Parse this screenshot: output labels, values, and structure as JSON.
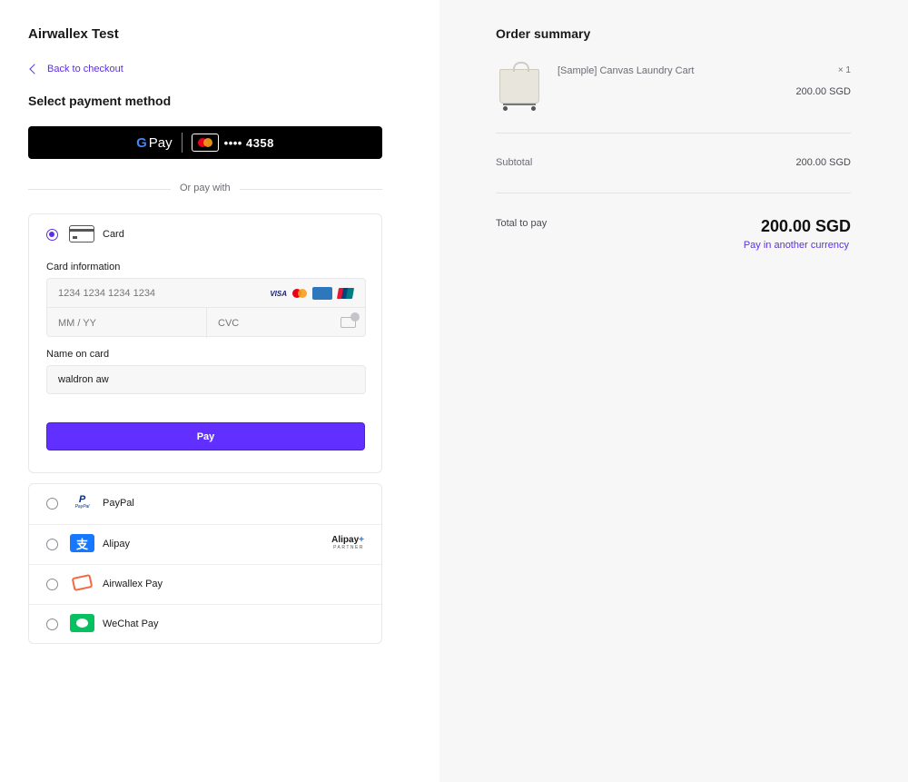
{
  "merchant": {
    "name": "Airwallex Test"
  },
  "nav": {
    "back_label": "Back to checkout"
  },
  "payment": {
    "title": "Select payment method",
    "google_pay": {
      "label": "Pay",
      "card_digits": "•••• 4358"
    },
    "divider_text": "Or pay with",
    "card": {
      "label": "Card",
      "info_label": "Card information",
      "number_placeholder": "1234 1234 1234 1234",
      "expiry_placeholder": "MM / YY",
      "cvc_placeholder": "CVC",
      "brands": {
        "visa": "VISA"
      },
      "name_label": "Name on card",
      "name_value": "waldron aw",
      "pay_button": "Pay"
    },
    "methods": [
      {
        "label": "PayPal",
        "icon": "paypal-icon"
      },
      {
        "label": "Alipay",
        "icon": "alipay-icon",
        "partner_badge": "Alipay",
        "partner_sub": "PARTNER"
      },
      {
        "label": "Airwallex Pay",
        "icon": "airwallex-pay-icon"
      },
      {
        "label": "WeChat Pay",
        "icon": "wechat-pay-icon"
      }
    ]
  },
  "order": {
    "title": "Order summary",
    "item": {
      "name": "[Sample] Canvas Laundry Cart",
      "quantity": "× 1",
      "price": "200.00 SGD"
    },
    "subtotal_label": "Subtotal",
    "subtotal_value": "200.00 SGD",
    "total_label": "Total to pay",
    "total_value": "200.00 SGD",
    "currency_link": "Pay in another currency"
  },
  "colors": {
    "accent": "#612fff",
    "link": "#5b2fe3",
    "right_panel_bg": "#f7f7f8"
  }
}
